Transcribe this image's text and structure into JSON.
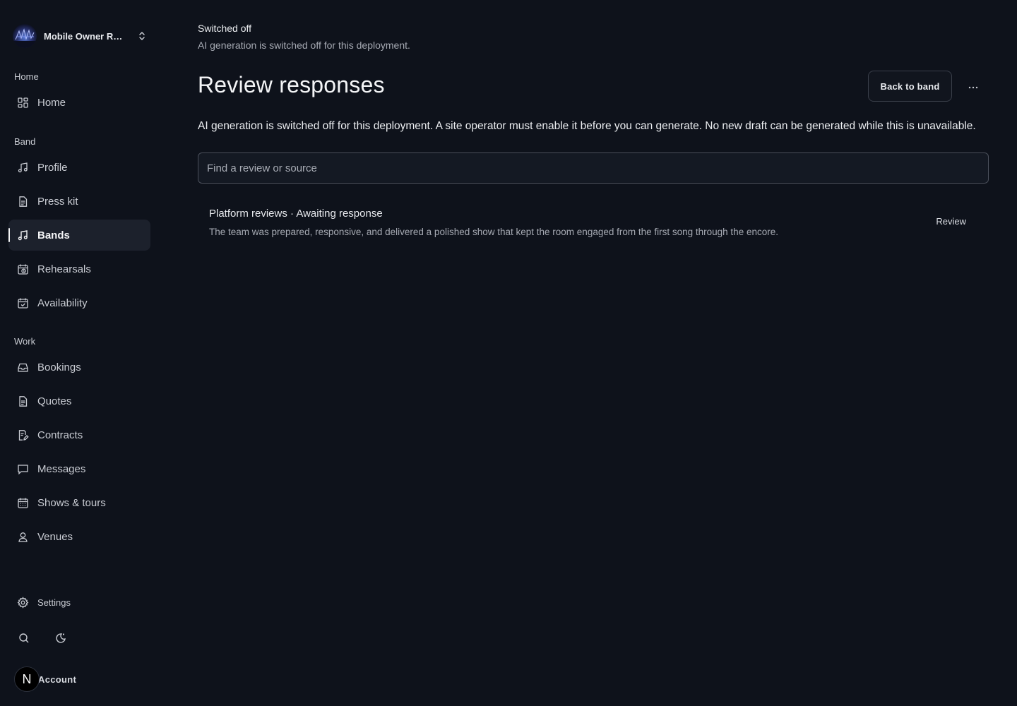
{
  "workspace": {
    "name": "Mobile Owner Re..."
  },
  "nav": {
    "sections": [
      {
        "label": "Home"
      },
      {
        "label": "Band"
      },
      {
        "label": "Work"
      }
    ],
    "items": [
      {
        "label": "Home",
        "icon": "grid-icon"
      },
      {
        "label": "Profile",
        "icon": "music-note-icon"
      },
      {
        "label": "Press kit",
        "icon": "document-icon"
      },
      {
        "label": "Bands",
        "icon": "music-note-icon",
        "active": true
      },
      {
        "label": "Rehearsals",
        "icon": "calendar-clock-icon"
      },
      {
        "label": "Availability",
        "icon": "calendar-check-icon"
      },
      {
        "label": "Bookings",
        "icon": "inbox-icon"
      },
      {
        "label": "Quotes",
        "icon": "document-icon"
      },
      {
        "label": "Contracts",
        "icon": "document-edit-icon"
      },
      {
        "label": "Messages",
        "icon": "message-icon"
      },
      {
        "label": "Shows & tours",
        "icon": "calendar-icon"
      },
      {
        "label": "Venues",
        "icon": "location-user-icon"
      }
    ],
    "settings": "Settings",
    "account": {
      "label": "Account",
      "avatar_letter": "N"
    }
  },
  "status": {
    "title": "Switched off",
    "description": "AI generation is switched off for this deployment."
  },
  "page": {
    "title": "Review responses",
    "back_label": "Back to band",
    "more_label": "···",
    "notice": "AI generation is switched off for this deployment. A site operator must enable it before you can generate. No new draft can be generated while this is unavailable."
  },
  "search": {
    "placeholder": "Find a review or source"
  },
  "reviews": [
    {
      "heading": "Platform reviews · Awaiting response",
      "text": "The team was prepared, responsive, and delivered a polished show that kept the room engaged from the first song through the encore.",
      "action": "Review"
    }
  ],
  "colors": {
    "background": "#0e121b",
    "active_item": "#1c212c",
    "border": "#4b505b"
  }
}
